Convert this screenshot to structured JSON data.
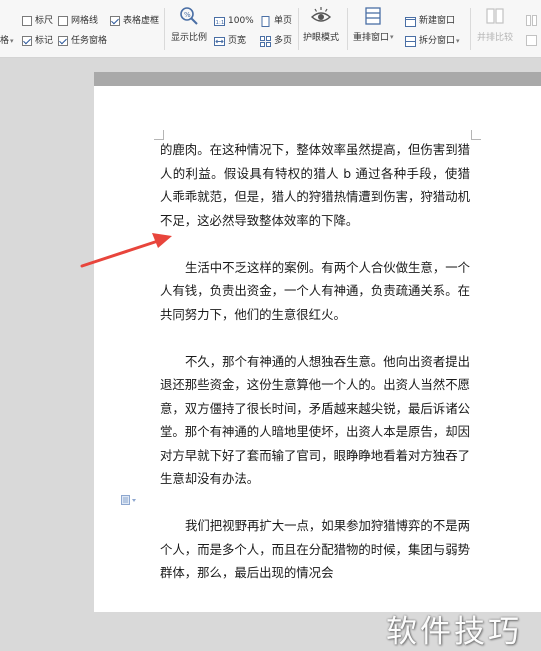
{
  "ribbon": {
    "left_cut_labels": [
      "格",
      "格"
    ],
    "checkboxes": [
      {
        "label": "标尺",
        "checked": false
      },
      {
        "label": "网格线",
        "checked": false
      },
      {
        "label": "表格虚框",
        "checked": true
      },
      {
        "label": "标记",
        "checked": true
      },
      {
        "label": "任务窗格",
        "checked": true
      }
    ],
    "show_ratio": "显示比例",
    "zoom_100": "100%",
    "page_width": "页宽",
    "single_page": "单页",
    "multi_page": "多页",
    "eye_protection": "护眼模式",
    "rearrange_window": "重排窗口",
    "new_window": "新建窗口",
    "split_window": "拆分窗口",
    "side_by_side": "并排比较"
  },
  "document": {
    "paragraphs": [
      "的鹿肉。在这种情况下，整体效率虽然提高，但伤害到猎人的利益。假设具有特权的猎人 b 通过各种手段，使猎人乖乖就范，但是，猎人的狩猎热情遭到伤害，狩猎动机不足，这必然导致整体效率的下降。",
      "生活中不乏这样的案例。有两个人合伙做生意，一个人有钱，负责出资金，一个人有神通，负责疏通关系。在共同努力下，他们的生意很红火。",
      "不久，那个有神通的人想独吞生意。他向出资者提出退还那些资金，这份生意算他一个人的。出资人当然不愿意，双方僵持了很长时间，矛盾越来越尖锐，最后诉诸公堂。那个有神通的人暗地里使坏，出资人本是原告，却因对方早就下好了套而输了官司，眼睁睁地看着对方独吞了生意却没有办法。",
      "我们把视野再扩大一点，如果参加狩猎博弈的不是两个人，而是多个人，而且在分配猎物的时候，集团与弱势群体，那么，最后出现的情况会"
    ]
  },
  "watermark": "软件技巧",
  "colors": {
    "accent": "#2b579a",
    "arrow": "#e8453c",
    "workspace": "#d9d9d9"
  }
}
